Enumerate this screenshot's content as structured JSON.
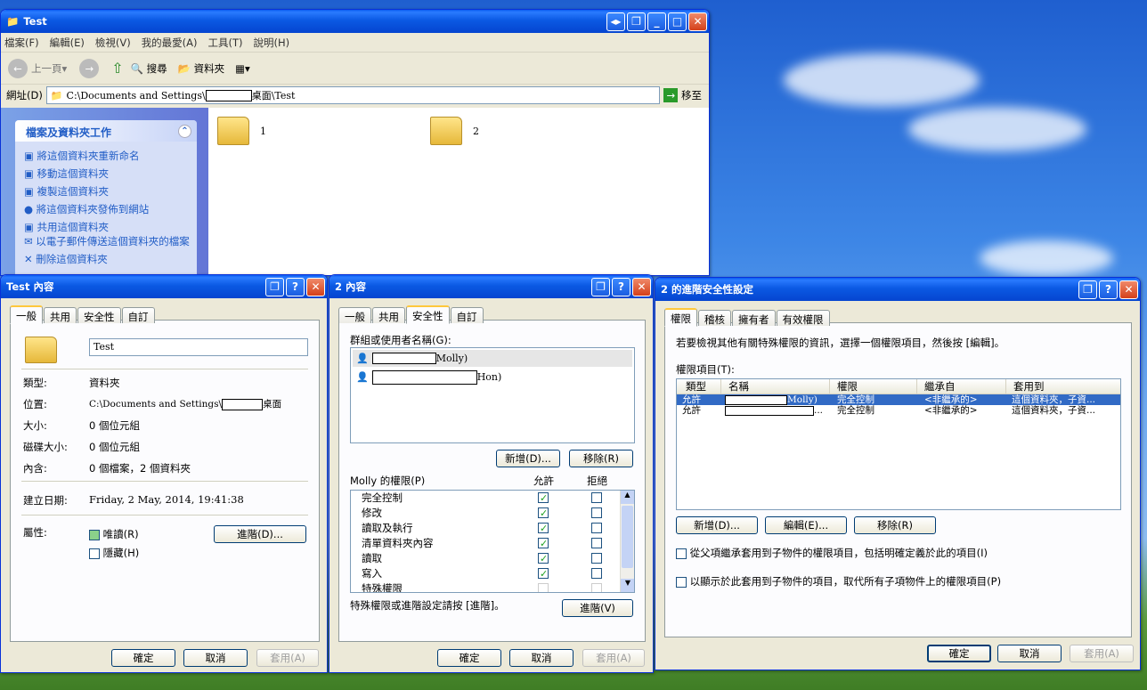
{
  "explorer": {
    "title": "Test",
    "menus": [
      "檔案(F)",
      "編輯(E)",
      "檢視(V)",
      "我的最愛(A)",
      "工具(T)",
      "說明(H)"
    ],
    "back": "上一頁",
    "search": "搜尋",
    "folders": "資料夾",
    "address_label": "網址(D)",
    "address_pre": "C:\\Documents and Settings\\",
    "address_post": "桌面\\Test",
    "go": "移至",
    "task_title": "檔案及資料夾工作",
    "tasks": [
      "將這個資料夾重新命名",
      "移動這個資料夾",
      "複製這個資料夾",
      "將這個資料夾發佈到網站",
      "共用這個資料夾",
      "以電子郵件傳送這個資料夾的檔案",
      "刪除這個資料夾"
    ],
    "items": [
      "1",
      "2"
    ]
  },
  "test_props": {
    "title": "Test 內容",
    "tabs": [
      "一般",
      "共用",
      "安全性",
      "自訂"
    ],
    "name": "Test",
    "rows": [
      {
        "k": "類型:",
        "v": "資料夾"
      },
      {
        "k": "位置:",
        "v": "C:\\Documents and Settings\\"
      },
      {
        "k": "大小:",
        "v": "0 個位元組"
      },
      {
        "k": "磁碟大小:",
        "v": "0 個位元組"
      },
      {
        "k": "內含:",
        "v": "0 個檔案，2 個資料夾"
      }
    ],
    "loc_post": "桌面",
    "created_label": "建立日期:",
    "created": "Friday, 2 May, 2014, 19:41:38",
    "attr_label": "屬性:",
    "readonly": "唯讀(R)",
    "hidden": "隱藏(H)",
    "advanced": "進階(D)...",
    "ok": "確定",
    "cancel": "取消",
    "apply": "套用(A)"
  },
  "props2": {
    "title": "2 內容",
    "tabs": [
      "一般",
      "共用",
      "安全性",
      "自訂"
    ],
    "group_label": "群組或使用者名稱(G):",
    "users": [
      "Molly)",
      "Hon)"
    ],
    "add": "新增(D)...",
    "remove": "移除(R)",
    "perm_label": "Molly 的權限(P)",
    "allow": "允許",
    "deny": "拒絕",
    "perms": [
      {
        "n": "完全控制",
        "a": true
      },
      {
        "n": "修改",
        "a": true
      },
      {
        "n": "讀取及執行",
        "a": true
      },
      {
        "n": "清單資料夾內容",
        "a": true
      },
      {
        "n": "讀取",
        "a": true
      },
      {
        "n": "寫入",
        "a": true
      },
      {
        "n": "特殊權限",
        "a": false
      }
    ],
    "special_note": "特殊權限或進階設定請按 [進階]。",
    "advanced": "進階(V)",
    "ok": "確定",
    "cancel": "取消",
    "apply": "套用(A)"
  },
  "adv": {
    "title": "2 的進階安全性設定",
    "tabs": [
      "權限",
      "稽核",
      "擁有者",
      "有效權限"
    ],
    "desc": "若要檢視其他有關特殊權限的資訊，選擇一個權限項目，然後按 [編輯]。",
    "entries_label": "權限項目(T):",
    "cols": [
      "類型",
      "名稱",
      "權限",
      "繼承自",
      "套用到"
    ],
    "rows": [
      {
        "type": "允許",
        "name": "Molly)",
        "perm": "完全控制",
        "inh": "<非繼承的>",
        "apply": "這個資料夾，子資..."
      },
      {
        "type": "允許",
        "name": "...",
        "perm": "完全控制",
        "inh": "<非繼承的>",
        "apply": "這個資料夾，子資..."
      }
    ],
    "add": "新增(D)...",
    "edit": "編輯(E)...",
    "remove": "移除(R)",
    "inherit": "從父項繼承套用到子物件的權限項目，包括明確定義於此的項目(I)",
    "replace": "以顯示於此套用到子物件的項目，取代所有子項物件上的權限項目(P)",
    "ok": "確定",
    "cancel": "取消",
    "apply": "套用(A)"
  }
}
